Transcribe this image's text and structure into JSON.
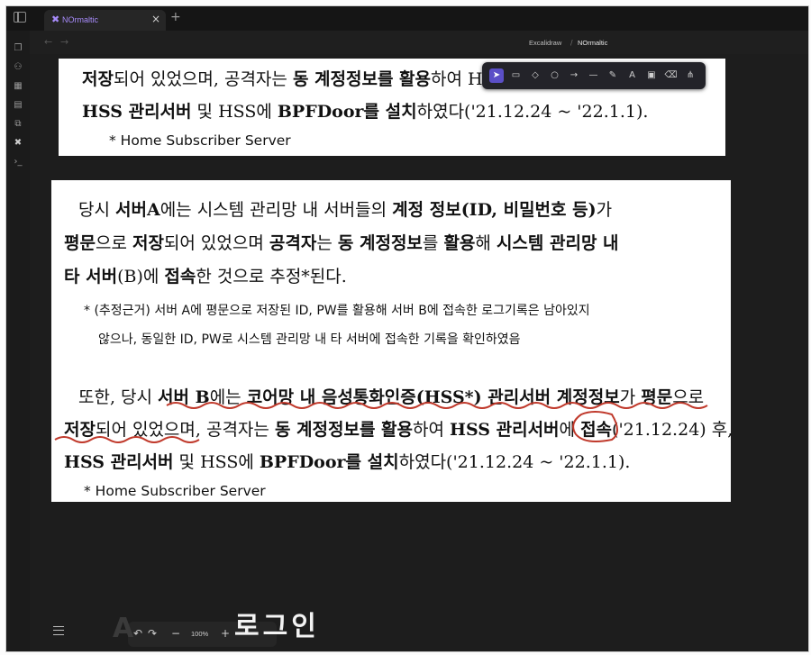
{
  "tab": {
    "title": "NOrmaltic",
    "icon": "excalidraw-icon"
  },
  "breadcrumb": {
    "folder": "Excalidraw",
    "file": "NOrmaltic"
  },
  "doc_top": {
    "line1_a": "저장",
    "line1_b": "되어 있었으며, 공격자는 ",
    "line1_c": "동 계정정보를 활용",
    "line1_d": "하여 HSS",
    "line2_a": "HSS 관리서버",
    "line2_b": " 및 HSS에 ",
    "line2_c": "BPFDoor를 설치",
    "line2_d": "하였다('21.12.24 ~ '22.1.1).",
    "footnote": "* Home Subscriber Server"
  },
  "doc_main": {
    "p1_l1": [
      {
        "t": "당시 ",
        "b": false
      },
      {
        "t": "서버A",
        "b": true
      },
      {
        "t": "에는 시스템 관리망 내 서버들의 ",
        "b": false
      },
      {
        "t": "계정 정보(ID, 비밀번호 등)",
        "b": true
      },
      {
        "t": "가",
        "b": false
      }
    ],
    "p1_l2": [
      {
        "t": "평문",
        "b": true
      },
      {
        "t": "으로 ",
        "b": false
      },
      {
        "t": "저장",
        "b": true
      },
      {
        "t": "되어 있었으며 ",
        "b": false
      },
      {
        "t": "공격자",
        "b": true
      },
      {
        "t": "는 ",
        "b": false
      },
      {
        "t": "동 계정정보",
        "b": true
      },
      {
        "t": "를 ",
        "b": false
      },
      {
        "t": "활용",
        "b": true
      },
      {
        "t": "해 ",
        "b": false
      },
      {
        "t": "시스템 관리망 내",
        "b": true
      }
    ],
    "p1_l3": [
      {
        "t": "타 서버",
        "b": true
      },
      {
        "t": "(B)에 ",
        "b": false
      },
      {
        "t": "접속",
        "b": true
      },
      {
        "t": "한 것으로 추정*된다.",
        "b": false
      }
    ],
    "note1": "* (추정근거) 서버 A에 평문으로 저장된 ID, PW를 활용해 서버 B에 접속한 로그기록은 남아있지",
    "note2": "않으나, 동일한 ID, PW로 시스템 관리망 내 타 서버에 접속한 기록을 확인하였음",
    "p2_l1": [
      {
        "t": "또한, 당시 ",
        "b": false
      },
      {
        "t": "서버 B",
        "b": true
      },
      {
        "t": "에는 ",
        "b": false
      },
      {
        "t": "코어망 내 음성통화인증(HSS*) 관리서버 계정정보",
        "b": true
      },
      {
        "t": "가 ",
        "b": false
      },
      {
        "t": "평문",
        "b": true
      },
      {
        "t": "으로",
        "b": false
      }
    ],
    "p2_l2": [
      {
        "t": "저장",
        "b": true
      },
      {
        "t": "되어 있었으며, 공격자는 ",
        "b": false
      },
      {
        "t": "동 계정정보를 활용",
        "b": true
      },
      {
        "t": "하여 ",
        "b": false
      },
      {
        "t": "HSS 관리서버",
        "b": true
      },
      {
        "t": "에 ",
        "b": false
      },
      {
        "t": "접속",
        "b": true
      },
      {
        "t": "('21.12.24) 후,",
        "b": false
      }
    ],
    "p2_l3": [
      {
        "t": "HSS 관리서버",
        "b": true
      },
      {
        "t": " 및 HSS에 ",
        "b": false
      },
      {
        "t": "BPFDoor를 설치",
        "b": true
      },
      {
        "t": "하였다('21.12.24 ~ '22.1.1).",
        "b": false
      }
    ],
    "footnote": "* Home Subscriber Server"
  },
  "toolbar": {
    "tools": [
      "selection-tool",
      "rectangle-tool",
      "diamond-tool",
      "ellipse-tool",
      "arrow-tool",
      "line-tool",
      "draw-tool",
      "text-tool",
      "image-tool",
      "eraser-tool",
      "more-tools"
    ],
    "glyphs": [
      "➤",
      "▭",
      "◇",
      "○",
      "→",
      "—",
      "✎",
      "A",
      "▣",
      "⌫",
      "⋔"
    ]
  },
  "zoom": {
    "minus": "−",
    "level": "100%",
    "plus": "+"
  },
  "undo": "↶",
  "redo": "↷",
  "caption": "로그인",
  "ribbon_icons": [
    "files-icon",
    "graph-icon",
    "grid-icon",
    "calendar-icon",
    "copy-icon",
    "excalidraw-icon",
    "terminal-icon"
  ],
  "colors": {
    "accent": "#a78bfa",
    "annotation": "#c0392b",
    "tool_active": "#5b4fc7"
  }
}
